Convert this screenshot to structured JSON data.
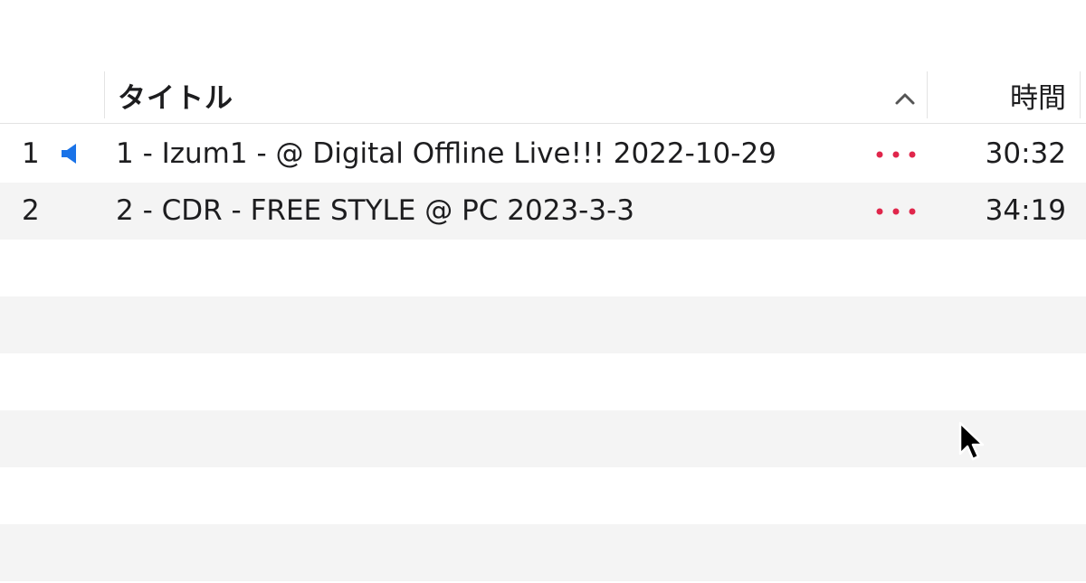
{
  "header": {
    "title_col": "タイトル",
    "time_col": "時間",
    "sort_icon": "chevron-up-icon"
  },
  "tracks": [
    {
      "num": "1",
      "title": "1 - Izum1 - @ Digital Offline Live!!! 2022-10-29",
      "time": "30:32",
      "playing": true
    },
    {
      "num": "2",
      "title": "2 - CDR - FREE STYLE @ PC 2023-3-3",
      "time": "34:19",
      "playing": false
    }
  ],
  "colors": {
    "accent": "#1a73e8",
    "more_dots": "#e0264b",
    "stripe": "#f4f4f4"
  }
}
